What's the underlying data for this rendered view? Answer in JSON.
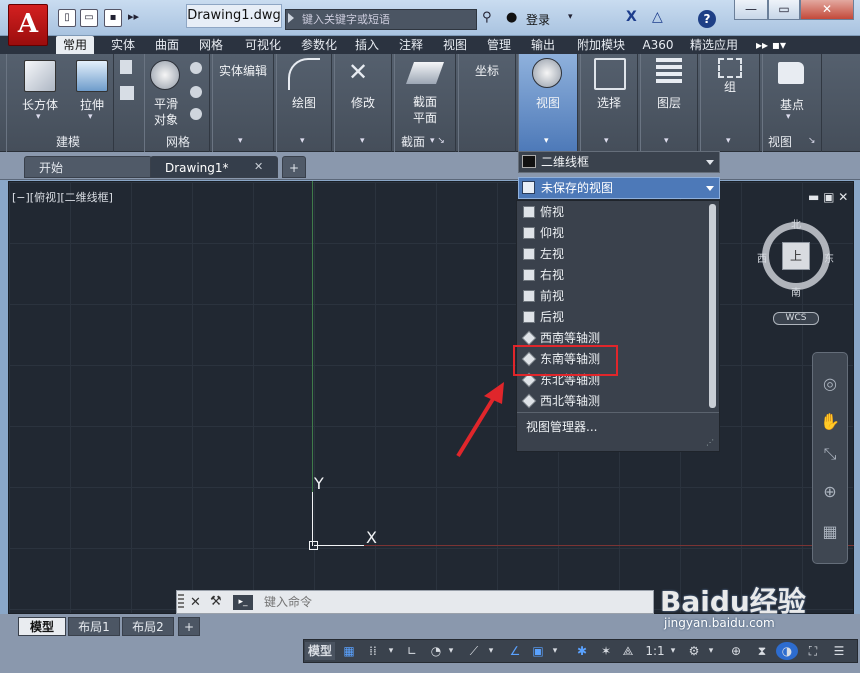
{
  "app": {
    "logo_letter": "A",
    "doc_title": "Drawing1.dwg",
    "search_placeholder": "键入关键字或短语",
    "login": "登录",
    "help": "?"
  },
  "ribbon_tabs": [
    "常用",
    "实体",
    "曲面",
    "网格",
    "可视化",
    "参数化",
    "插入",
    "注释",
    "视图",
    "管理",
    "输出",
    "附加模块",
    "A360",
    "精选应用"
  ],
  "ribbon": {
    "box": "长方体",
    "extrude": "拉伸",
    "smooth": "平滑\n对象",
    "modeling": "建模",
    "mesh": "网格",
    "solid_edit": "实体编辑",
    "draw": "绘图",
    "modify": "修改",
    "section_plane": "截面\n平面",
    "section": "截面",
    "coords": "坐标",
    "view": "视图",
    "select": "选择",
    "layers": "图层",
    "group": "组",
    "base": "基点",
    "view_panel": "视图"
  },
  "file_tabs": {
    "start": "开始",
    "drawing": "Drawing1*",
    "new": "+"
  },
  "viewport_label": "[−][俯视][二维线框]",
  "ucs": {
    "x": "X",
    "y": "Y"
  },
  "viewcube": {
    "north": "北",
    "south": "南",
    "east": "东",
    "west": "西",
    "top": "上",
    "wcs": "WCS"
  },
  "dropdown": {
    "visual_style": "二维线框",
    "current_view": "未保存的视图",
    "items": [
      "俯视",
      "仰视",
      "左视",
      "右视",
      "前视",
      "后视",
      "西南等轴测",
      "东南等轴测",
      "东北等轴测",
      "西北等轴测"
    ],
    "highlighted": "东南等轴测",
    "manager": "视图管理器..."
  },
  "command": {
    "placeholder": "键入命令"
  },
  "layout_tabs": [
    "模型",
    "布局1",
    "布局2",
    "+"
  ],
  "status": {
    "model": "模型",
    "scale": "1:1"
  },
  "watermark": {
    "logo": "Baidu经验",
    "url": "jingyan.baidu.com"
  },
  "colors": {
    "accent": "#4d79b8",
    "highlight": "#e0262b",
    "canvas": "#212832"
  }
}
